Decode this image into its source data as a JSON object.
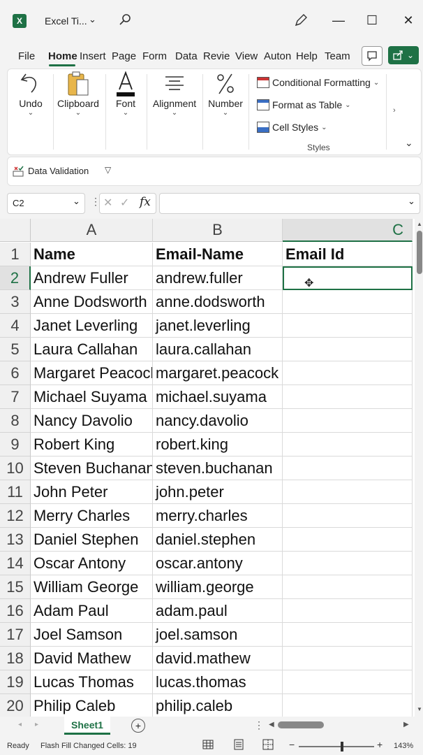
{
  "window": {
    "title": "Excel Ti...",
    "minimize": "—",
    "maximize": "☐",
    "close": "✕"
  },
  "menu": {
    "tabs": [
      "File",
      "Home",
      "Insert",
      "Page",
      "Form",
      "Data",
      "Revie",
      "View",
      "Auton",
      "Help",
      "Team"
    ],
    "active": "Home"
  },
  "ribbon": {
    "undo": "Undo",
    "clipboard": "Clipboard",
    "font": "Font",
    "alignment": "Alignment",
    "number": "Number",
    "conditional_formatting": "Conditional Formatting",
    "format_as_table": "Format as Table",
    "cell_styles": "Cell Styles",
    "styles_group": "Styles"
  },
  "data_validation": "Data Validation",
  "formula_bar": {
    "name_box": "C2",
    "fx": "fx",
    "formula": ""
  },
  "columns": [
    "A",
    "B",
    "C"
  ],
  "sheet": {
    "headers": [
      "Name",
      "Email-Name",
      "Email Id"
    ],
    "rows": [
      [
        "Andrew Fuller",
        "andrew.fuller"
      ],
      [
        "Anne  Dodsworth",
        "anne.dodsworth"
      ],
      [
        "Janet  Leverling",
        "janet.leverling"
      ],
      [
        "Laura Callahan",
        "laura.callahan"
      ],
      [
        "Margaret Peacock",
        "margaret.peacock"
      ],
      [
        "Michael Suyama",
        "michael.suyama"
      ],
      [
        "Nancy Davolio",
        "nancy.davolio"
      ],
      [
        "Robert King",
        "robert.king"
      ],
      [
        "Steven  Buchanan",
        "steven.buchanan"
      ],
      [
        "John Peter",
        "john.peter"
      ],
      [
        "Merry Charles",
        "merry.charles"
      ],
      [
        "Daniel  Stephen",
        "daniel.stephen"
      ],
      [
        "Oscar Antony",
        "oscar.antony"
      ],
      [
        "William  George",
        "william.george"
      ],
      [
        "Adam Paul",
        "adam.paul"
      ],
      [
        "Joel Samson",
        "joel.samson"
      ],
      [
        "David Mathew",
        "david.mathew"
      ],
      [
        "Lucas Thomas",
        "lucas.thomas"
      ],
      [
        "Philip Caleb",
        "philip.caleb"
      ]
    ]
  },
  "sheet_tab": "Sheet1",
  "status": {
    "ready": "Ready",
    "flash_fill": "Flash Fill Changed Cells: 19",
    "zoom": "143%",
    "zoom_minus": "−",
    "zoom_plus": "+"
  },
  "colors": {
    "accent": "#1e7145"
  }
}
